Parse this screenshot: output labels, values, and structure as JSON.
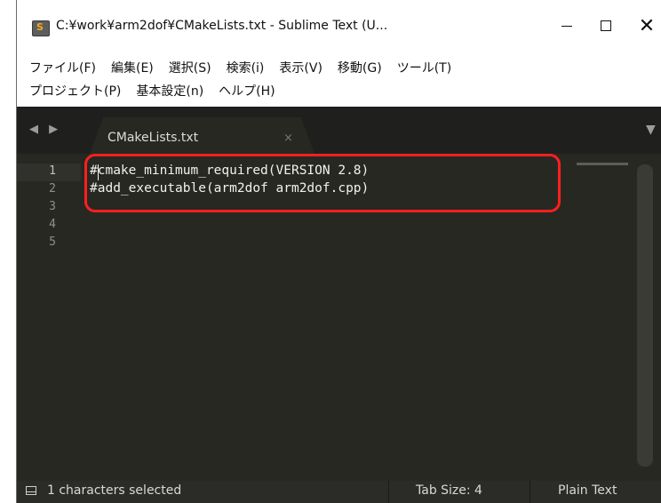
{
  "window": {
    "title": "C:¥work¥arm2dof¥CMakeLists.txt - Sublime Text (U...",
    "controls": {
      "minimize_icon": "minimize-icon",
      "maximize_icon": "maximize-icon",
      "close_glyph": "✕"
    }
  },
  "menu": {
    "row1": [
      "ファイル(F)",
      "編集(E)",
      "選択(S)",
      "検索(i)",
      "表示(V)",
      "移動(G)",
      "ツール(T)"
    ],
    "row2": [
      "プロジェクト(P)",
      "基本設定(n)",
      "ヘルプ(H)"
    ]
  },
  "tabs": {
    "nav_arrows": "◀ ▶",
    "active_tab": {
      "label": "CMakeLists.txt",
      "close": "×"
    },
    "dropdown": "▼"
  },
  "editor": {
    "line_numbers": [
      "1",
      "2",
      "3",
      "4",
      "5"
    ],
    "lines": [
      "#cmake_minimum_required(VERSION 2.8)",
      "#add_executable(arm2dof arm2dof.cpp)"
    ],
    "annotation_color": "#ff1f1f",
    "background": "#272822"
  },
  "status": {
    "selection": "1 characters selected",
    "tab_size": "Tab Size: 4",
    "syntax": "Plain Text"
  }
}
